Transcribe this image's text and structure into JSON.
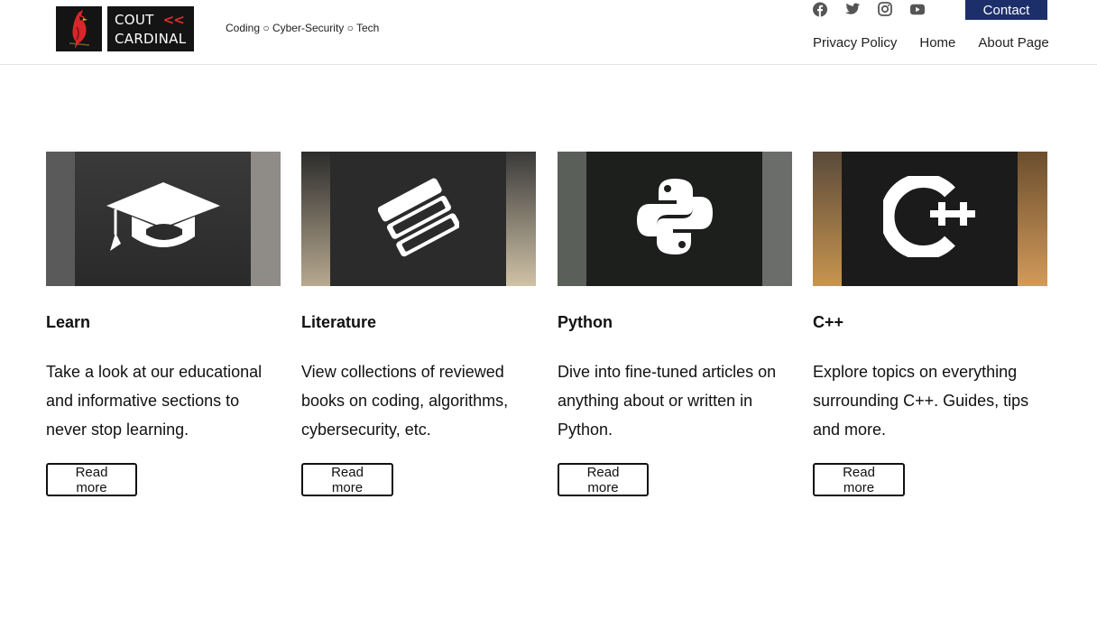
{
  "brand": {
    "line1": "COUT",
    "arrows": "<<",
    "line2": "CARDINAL",
    "tagline": "Coding ○ Cyber-Security ○ Tech"
  },
  "social": [
    {
      "name": "facebook-icon"
    },
    {
      "name": "twitter-icon"
    },
    {
      "name": "instagram-icon"
    },
    {
      "name": "youtube-icon"
    }
  ],
  "header": {
    "contact_label": "Contact",
    "nav": [
      "Privacy Policy",
      "Home",
      "About Page"
    ]
  },
  "cards": [
    {
      "title": "Learn",
      "description": "Take a look at our educational and informative sections to never stop learning.",
      "button": "Read more",
      "icon": "graduation-cap-icon"
    },
    {
      "title": "Literature",
      "description": "View collections of reviewed books on coding, algorithms, cybersecurity, etc.",
      "button": "Read more",
      "icon": "books-icon"
    },
    {
      "title": "Python",
      "description": "Dive into fine-tuned articles on anything about or written in Python.",
      "button": "Read more",
      "icon": "python-icon"
    },
    {
      "title": "C++",
      "description": "Explore topics on everything surrounding C++. Guides, tips and more.",
      "button": "Read more",
      "icon": "cpp-icon"
    }
  ],
  "colors": {
    "accent": "#1d2f6a",
    "logo_bg": "#141414",
    "logo_red": "#e0302a"
  }
}
